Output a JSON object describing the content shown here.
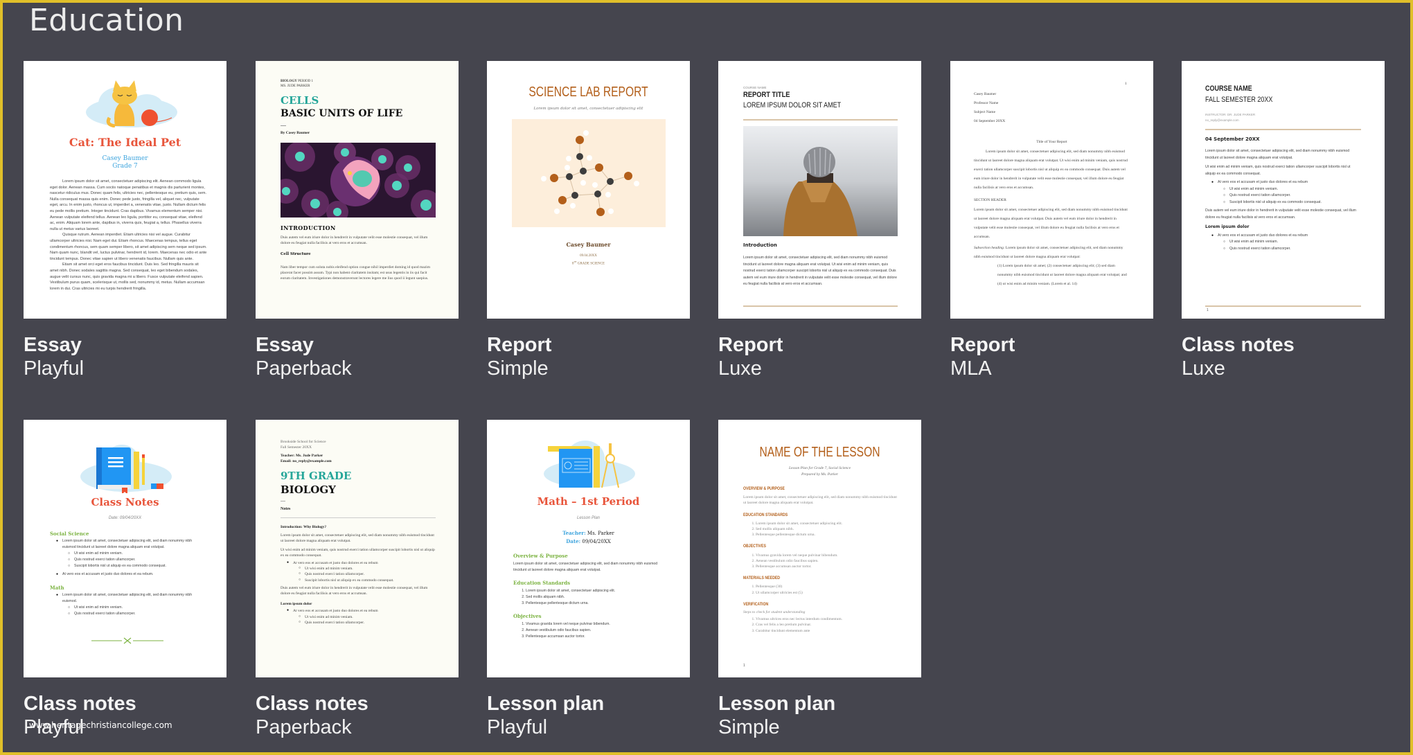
{
  "section_title": "Education",
  "watermark": "www.heritagechristiancollege.com",
  "colors": {
    "background": "#45454e",
    "frame_border": "#e0bf2a",
    "playful_title": "#e8553b",
    "playful_blue": "#3ba3dd",
    "playful_green": "#7cb342",
    "paperback_teal": "#26a69a",
    "simple_orange": "#b35f1a",
    "luxe_rule": "#d9c4a8"
  },
  "templates": [
    {
      "title": "Essay",
      "subtitle": "Playful",
      "preview": {
        "heading": "Cat: The Ideal Pet",
        "author": "Casey Baumer",
        "grade": "Grade 7",
        "paragraphs": [
          "Lorem ipsum dolor sit amet, consectetuer adipiscing elit. Aenean commodo ligula eget dolor. Aenean massa. Cum sociis natoque penatibus et magnis dis parturient montes, nascetur ridiculus mus. Donec quam felis, ultricies nec, pellentesque eu, pretium quis, sem. Nulla consequat massa quis enim. Donec pede justo, fringilla vel, aliquet nec, vulputate eget, arcu. In enim justo, rhoncus ut, imperdiet a, venenatis vitae, justo. Nullam dictum felis eu pede mollis pretium. Integer tincidunt. Cras dapibus. Vivamus elementum semper nisi. Aenean vulputate eleifend tellus. Aenean leo ligula, porttitor eu, consequat vitae, eleifend ac, enim. Aliquam lorem ante, dapibus in, viverra quis, feugiat a, tellus. Phasellus viverra nulla ut metus varius laoreet.",
          "Quisque rutrum. Aenean imperdiet. Etiam ultricies nisi vel augue. Curabitur ullamcorper ultricies nisi. Nam eget dui. Etiam rhoncus. Maecenas tempus, tellus eget condimentum rhoncus, sem quam semper libero, sit amet adipiscing sem neque sed ipsum. Nam quam nunc, blandit vel, luctus pulvinar, hendrerit id, lorem. Maecenas nec odio et ante tincidunt tempus. Donec vitae sapien ut libero venenatis faucibus. Nullam quis ante.",
          "Etiam sit amet orci eget eros faucibus tincidunt. Duis leo. Sed fringilla mauris sit amet nibh. Donec sodales sagittis magna. Sed consequat, leo eget bibendum sodales, augue velit cursus nunc, quis gravida magna mi a libero. Fusce vulputate eleifend sapien. Vestibulum purus quam, scelerisque ut, mollis sed, nonummy id, metus. Nullam accumsan lorem in dui. Cras ultricies mi eu turpis hendrerit fringilla."
        ]
      }
    },
    {
      "title": "Essay",
      "subtitle": "Paperback",
      "preview": {
        "course_bold": "BIOLOGY",
        "course_rest": "PERIOD 1",
        "teacher": "MS. JUDE PARKER",
        "heading_accent": "CELLS",
        "heading_main": "BASIC UNITS OF LIFE",
        "byline": "By Casey Baumer",
        "section1": "INTRODUCTION",
        "section1_text": "Duis autem vel eum iriure dolor in hendrerit in vulputate velit esse molestie consequat, vel illum dolore eu feugiat nulla facilisis at vero eros et accumsan.",
        "section2": "Cell Structure",
        "section2_text": "Nam liber tempor cum soluta nobis eleifend option congue nihil imperdiet doming id quod mazim placerat facer possim assum. Typi non habent claritatem insitam; est usus legentis in iis qui facit eorum claritatem. Investigationes demonstraverunt lectores legere me lius quod ii legunt saepius."
      }
    },
    {
      "title": "Report",
      "subtitle": "Simple",
      "preview": {
        "heading": "SCIENCE LAB REPORT",
        "tagline": "Lorem ipsum dolor sit amet, consectetuer adipiscing elit",
        "author": "Casey Baumer",
        "date": "09.04.20XX",
        "class_num": "8",
        "class_sup": "TH",
        "class_rest": "GRADE SCIENCE"
      }
    },
    {
      "title": "Report",
      "subtitle": "Luxe",
      "preview": {
        "course": "COURSE NAME",
        "heading": "REPORT TITLE",
        "subheading": "LOREM IPSUM DOLOR SIT AMET",
        "section": "Introduction",
        "text": "Lorem ipsum dolor sit amet, consectetuer adipiscing elit, sed diam nonummy nibh euismod tincidunt ut laoreet dolore magna aliquam erat volutpat. Ut wisi enim ad minim veniam, quis nostrud exerci tation ullamcorper suscipit lobortis nisl ut aliquip ex ea commodo consequat. Duis autem vel eum iriure dolor in hendrerit in vulputate velit esse molestie consequat, vel illum dolore eu feugiat nulla facilisis at vero eros et accumsan."
      }
    },
    {
      "title": "Report",
      "subtitle": "MLA",
      "preview": {
        "page_number": "1",
        "header_lines": [
          "Casey Baumer",
          "Professor Name",
          "Subject Name",
          "04 September 20XX"
        ],
        "doc_title": "Title of Your Report",
        "para1": "Lorem ipsum dolor sit amet, consectetuer adipiscing elit, sed diam nonummy nibh euismod tincidunt ut laoreet dolore magna aliquam erat volutpat. Ut wisi enim ad minim veniam, quis nostrud exerci tation ullamcorper suscipit lobortis nisl ut aliquip ex ea commodo consequat. Duis autem vel eum iriure dolor in hendrerit in vulputate velit esse molestie consequat, vel illum dolore eu feugiat nulla facilisis at vero eros et accumsan.",
        "section": "SECTION HEADER",
        "para2": "Lorem ipsum dolor sit amet, consectetuer adipiscing elit, sed diam nonummy nibh euismod tincidunt ut laoreet dolore magna aliquam erat volutpat. Duis autem vel eum iriure dolor in hendrerit in vulputate velit esse molestie consequat, vel illum dolore eu feugiat nulla facilisis at vero eros et accumsan.",
        "subsection": "Subsection heading.",
        "para3": "Lorem ipsum dolor sit amet, consectetuer adipiscing elit, sed diam nonummy nibh euismod tincidunt ut laoreet dolore magna aliquam erat volutpat:",
        "quote": "(1) Lorem ipsum dolor sit amet; (2) consectetuer adipiscing elit; (3) sed diam nonummy nibh euismod tincidunt ut laoreet dolore magna aliquam erat volutpat; and (4) ut wisi enim ad minim veniam.  (Lorem et al. 14)"
      }
    },
    {
      "title": "Class notes",
      "subtitle": "Luxe",
      "preview": {
        "heading": "COURSE NAME",
        "subheading": "FALL SEMESTER 20XX",
        "instructor": "INSTRUCTOR: DR. JUDE PARKER",
        "email": "no_reply@example.com",
        "date": "04 September 20XX",
        "para1": "Lorem ipsum dolor sit amet, consectetuer adipiscing elit, sed diam nonummy nibh euismod tincidunt ut laoreet dolore magna aliquam erat volutpat.",
        "para2": "Ut wisi enim ad minim veniam, quis nostrud exerci tation ullamcorper suscipit lobortis nisl ut aliquip ex ea commodo consequat.",
        "bullet1": "At vero eos et accusam et justo duo dolores et ea rebum",
        "subs1": [
          "Ut wisi enim ad minim veniam.",
          "Quis nostrud exerci tation ullamcorper.",
          "Suscipit lobortis nisl ut aliquip ex ea commodo consequat."
        ],
        "para3": "Duis autem vel eum iriure dolor in hendrerit in vulputate velit esse molestie consequat, vel illum dolore eu feugiat nulla facilisis at vero eros et accumsan.",
        "section2": "Lorem ipsum dolor",
        "bullet2": "At vero eos et accusam et justo duo dolores et ea rebum",
        "subs2": [
          "Ut wisi enim ad minim veniam.",
          "Quis nostrud exerci tation ullamcorper."
        ],
        "page_number": "1"
      }
    },
    {
      "title": "Class notes",
      "subtitle": "Playful",
      "preview": {
        "heading": "Class Notes",
        "date": "Date: 09/04/20XX",
        "section1": "Social Science",
        "s1_bullet1": "Lorem ipsum dolor sit amet, consectetuer adipiscing elit, sed diam nonummy nibh euismod tincidunt ut laoreet dolore magna aliquam erat volutpat.",
        "s1_subs": [
          "Ut wisi enim ad minim veniam.",
          "Quis nostrud exerci tation ullamcorper.",
          "Suscipit lobortis nisl ut aliquip ex ea commodo consequat."
        ],
        "s1_bullet2": "At vero eos et accusam et justo duo dolores et ea rebum.",
        "section2": "Math",
        "s2_bullet1": "Lorem ipsum dolor sit amet, consectetuer adipiscing elit, sed diam nonummy nibh euismod.",
        "s2_subs": [
          "Ut wisi enim ad minim veniam.",
          "Quis nostrud exerci tation ullamcorper."
        ]
      }
    },
    {
      "title": "Class notes",
      "subtitle": "Paperback",
      "preview": {
        "school": "Brookside School for Science",
        "semester": "Fall Semester 20XX",
        "teacher": "Teacher: Ms. Jude Parker",
        "email": "Email: no_reply@example.com",
        "heading_accent": "9TH GRADE",
        "heading_main": "BIOLOGY",
        "notes_label": "Notes",
        "section1": "Introduction: Why Biology?",
        "para1": "Lorem ipsum dolor sit amet, consectetuer adipiscing elit, sed diam nonummy nibh euismod tincidunt ut laoreet dolore magna aliquam erat volutpat.",
        "para2": "Ut wisi enim ad minim veniam, quis nostrud exerci tation ullamcorper suscipit lobortis nisl ut aliquip ex ea commodo consequat.",
        "bullet1": "At vero eos et accusam et justo duo dolores et ea rebum",
        "subs1": [
          "Ut wisi enim ad minim veniam.",
          "Quis nostrud exerci tation ullamcorper.",
          "Suscipit lobortis nisl ut aliquip ex ea commodo consequat."
        ],
        "para3": "Duis autem vel eum iriure dolor in hendrerit in vulputate velit esse molestie consequat, vel illum dolore eu feugiat nulla facilisis at vero eros et accumsan.",
        "section2": "Lorem ipsum dolor",
        "bullet2": "At vero eos et accusam et justo duo dolores et ea rebum",
        "subs2": [
          "Ut wisi enim ad minim veniam.",
          "Quis nostrud exerci tation ullamcorper."
        ]
      }
    },
    {
      "title": "Lesson plan",
      "subtitle": "Playful",
      "preview": {
        "heading": "Math – 1st Period",
        "kind": "Lesson Plan",
        "teacher_label": "Teacher:",
        "teacher": "Ms. Parker",
        "date_label": "Date:",
        "date": "09/04/20XX",
        "section1": "Overview & Purpose",
        "section1_text": "Lorem ipsum dolor sit amet, consectetuer adipiscing elit, sed diam nonummy nibh euismod tincidunt ut laoreet dolore magna aliquam erat volutpat.",
        "section2": "Education Standards",
        "standards": [
          "Lorem ipsum dolor sit amet, consectetuer adipiscing elit.",
          "Sed mollis aliquam nibh.",
          "Pellentesque pellentesque dictum urna."
        ],
        "section3": "Objectives",
        "objectives": [
          "Vivamus gravida lorem vel neque pulvinar bibendum.",
          "Aenean vestibulum odio faucibus sapien.",
          "Pellentesque accumsan auctor tortor."
        ]
      }
    },
    {
      "title": "Lesson plan",
      "subtitle": "Simple",
      "preview": {
        "heading": "NAME OF THE LESSON",
        "sub1": "Lesson Plan for Grade 7, Social Science",
        "sub2": "Prepared by Ms. Parker",
        "section1": "OVERVIEW & PURPOSE",
        "section1_text": "Lorem ipsum dolor sit amet, consectetuer adipiscing elit, sed diam nonummy nibh euismod tincidunt ut laoreet dolore magna aliquam erat volutpat.",
        "section2": "EDUCATION STANDARDS",
        "standards": [
          "Lorem ipsum dolor sit amet, consectetuer adipiscing elit.",
          "Sed mollis aliquam nibh.",
          "Pellentesque pellentesque dictum urna."
        ],
        "section3": "OBJECTIVES",
        "objectives": [
          "Vivamus gravida lorem vel neque pulvinar bibendum.",
          "Aenean vestibulum odio faucibus sapien.",
          "Pellentesque accumsan auctor tortor."
        ],
        "section4": "MATERIALS NEEDED",
        "materials": [
          "Pellentesque (30)",
          "Ut ullamcorper ultricies est (5)"
        ],
        "section5": "VERIFICATION",
        "verification_note": "Steps to check for student understanding",
        "verification": [
          "Vivamus ultrices eros nec lectus interdum condimentum.",
          "Cras vel felis a leo pretium pulvinar.",
          "Curabitur tincidunt elementum ante"
        ],
        "page_number": "1"
      }
    }
  ]
}
